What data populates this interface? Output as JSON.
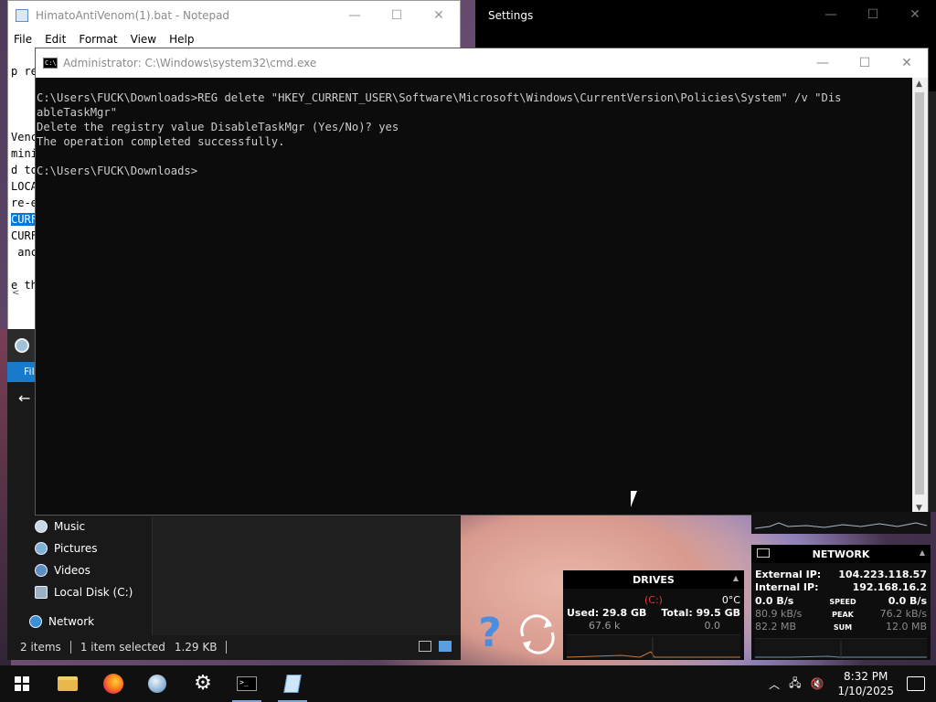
{
  "notepad": {
    "title": "HimatoAntiVenom(1).bat - Notepad",
    "menu": [
      "File",
      "Edit",
      "Format",
      "View",
      "Help"
    ],
    "lines": [
      {
        "text": "p re",
        "selected": false
      },
      {
        "text": "Venc",
        "selected": false
      },
      {
        "text": "mini",
        "selected": false
      },
      {
        "text": "d to",
        "selected": false
      },
      {
        "text": "LOCA",
        "selected": false
      },
      {
        "text": "re-e",
        "selected": false
      },
      {
        "text": "CURF",
        "selected": true
      },
      {
        "text": "CURF",
        "selected": false
      },
      {
        "text": " anc",
        "selected": false
      },
      {
        "text": "e th",
        "selected": false
      }
    ],
    "scroll_left_glyph": "<"
  },
  "settings": {
    "title": "Settings"
  },
  "cmd": {
    "title": "Administrator: C:\\Windows\\system32\\cmd.exe",
    "icon_text": "C:\\",
    "lines": [
      "C:\\Users\\FUCK\\Downloads>REG delete \"HKEY_CURRENT_USER\\Software\\Microsoft\\Windows\\CurrentVersion\\Policies\\System\" /v \"Dis",
      "ableTaskMgr\"",
      "Delete the registry value DisableTaskMgr (Yes/No)? yes",
      "The operation completed successfully.",
      "",
      "C:\\Users\\FUCK\\Downloads>"
    ]
  },
  "window_buttons": {
    "minimize": "—",
    "maximize": "☐",
    "close": "✕"
  },
  "explorer": {
    "ribbon_file": "Fil",
    "back_glyph": "←",
    "nav": [
      {
        "label": "Music",
        "icon": "music-icon"
      },
      {
        "label": "Pictures",
        "icon": "pictures-icon"
      },
      {
        "label": "Videos",
        "icon": "videos-icon"
      },
      {
        "label": "Local Disk (C:)",
        "icon": "disk-icon"
      },
      {
        "label": "Network",
        "icon": "network-icon"
      }
    ],
    "status": {
      "items": "2 items",
      "selected": "1 item selected",
      "size": "1.29 KB"
    }
  },
  "desktop": {
    "help_glyph": "?"
  },
  "drives_widget": {
    "title": "DRIVES",
    "drive_letter": "(C:)",
    "temp": "0°C",
    "used": "Used: 29.8 GB",
    "total": "Total: 99.5 GB",
    "read": "67.6 k",
    "write": "0.0"
  },
  "network_widget": {
    "title": "NETWORK",
    "external_ip_label": "External IP:",
    "external_ip": "104.223.118.57",
    "internal_ip_label": "Internal IP:",
    "internal_ip": "192.168.16.2",
    "speed_label": "SPEED",
    "speed_down": "0.0 B/s",
    "speed_up": "0.0 B/s",
    "peak_label": "PEAK",
    "peak_down": "80.9 kB/s",
    "peak_up": "76.2 kB/s",
    "sum_label": "SUM",
    "sum_down": "82.2 MB",
    "sum_up": "12.0 MB"
  },
  "taskbar": {
    "clock_time": "8:32 PM",
    "clock_date": "1/10/2025",
    "apps": [
      "start",
      "file-explorer",
      "firefox",
      "globe-app",
      "settings",
      "command-prompt",
      "notepad"
    ]
  },
  "colors": {
    "accent": "#0078d7",
    "console_text": "#cccccc",
    "console_bg": "#0c0c0c",
    "drive_letter": "#e23a3a"
  }
}
